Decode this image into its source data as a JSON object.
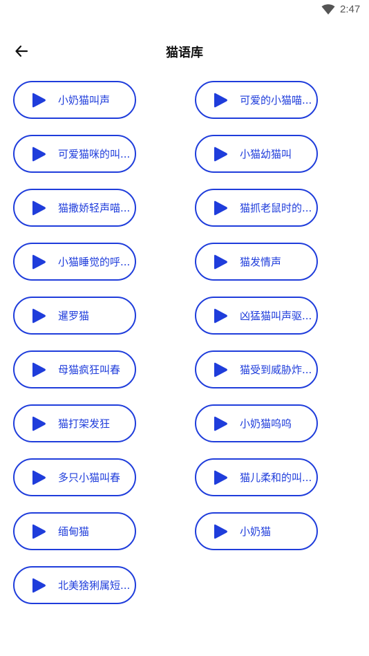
{
  "status_bar": {
    "time": "2:47",
    "icons": [
      "wifi-icon"
    ]
  },
  "app_bar": {
    "title": "猫语库",
    "back_icon": "arrow-left-icon"
  },
  "colors": {
    "accent": "#1f3ddb",
    "title": "#111111",
    "background": "#ffffff"
  },
  "sounds": [
    {
      "label": "小奶猫叫声"
    },
    {
      "label": "可爱的小猫喵..."
    },
    {
      "label": "可爱猫咪的叫..."
    },
    {
      "label": "小猫幼猫叫"
    },
    {
      "label": "猫撒娇轻声喵..."
    },
    {
      "label": "猫抓老鼠时的..."
    },
    {
      "label": "小猫睡觉的呼..."
    },
    {
      "label": "猫发情声"
    },
    {
      "label": "暹罗猫"
    },
    {
      "label": "凶猛猫叫声驱..."
    },
    {
      "label": "母猫疯狂叫春"
    },
    {
      "label": "猫受到威胁炸..."
    },
    {
      "label": "猫打架发狂"
    },
    {
      "label": "小奶猫呜呜"
    },
    {
      "label": "多只小猫叫春"
    },
    {
      "label": "猫儿柔和的叫..."
    },
    {
      "label": "缅甸猫"
    },
    {
      "label": "小奶猫"
    },
    {
      "label": "北美猞猁属短..."
    }
  ]
}
